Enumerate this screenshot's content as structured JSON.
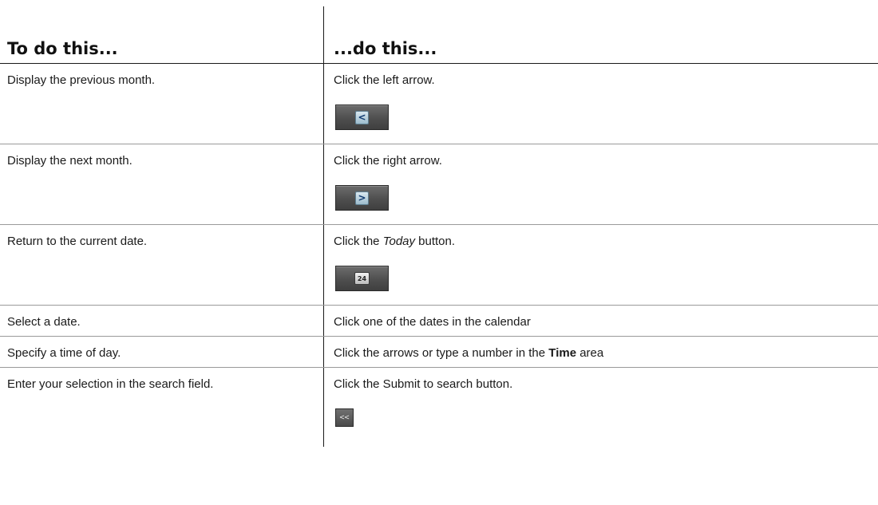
{
  "table": {
    "headers": {
      "col1": "To do this...",
      "col2": "...do this..."
    },
    "rows": [
      {
        "task": "Display the previous month.",
        "action": "Click the left arrow.",
        "button_glyph": "<"
      },
      {
        "task": "Display the next month.",
        "action": "Click the right arrow.",
        "button_glyph": ">"
      },
      {
        "task": "Return to the current date.",
        "action_pre": "Click the ",
        "action_em": "Today",
        "action_post": " button.",
        "button_glyph": "24"
      },
      {
        "task": "Select a date.",
        "action": "Click one of the dates in the calendar"
      },
      {
        "task": "Specify a time of day.",
        "action_pre": "Click the arrows or type a number in the ",
        "action_strong": "Time",
        "action_post": " area"
      },
      {
        "task": "Enter your selection in the search field.",
        "action": "Click the Submit to search button.",
        "button_glyph": "<<"
      }
    ]
  },
  "icons": {
    "left_arrow": "left-arrow-icon",
    "right_arrow": "right-arrow-icon",
    "today": "calendar-today-icon",
    "submit": "double-chevron-left-icon"
  }
}
